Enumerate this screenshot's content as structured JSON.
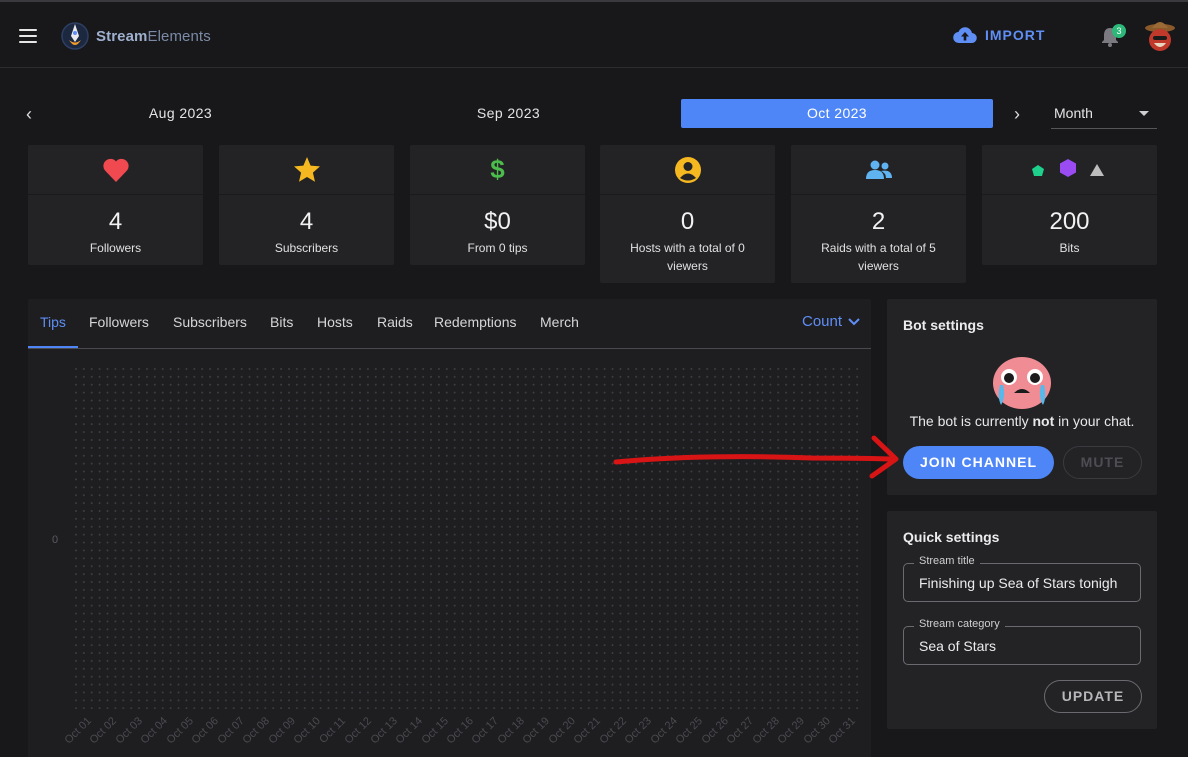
{
  "app": {
    "brand_prefix": "Stream",
    "brand_suffix": "Elements"
  },
  "header": {
    "import_label": "IMPORT",
    "notification_count": "3"
  },
  "date_nav": {
    "months": [
      {
        "label": "Aug 2023",
        "active": false
      },
      {
        "label": "Sep 2023",
        "active": false
      },
      {
        "label": "Oct 2023",
        "active": true
      }
    ],
    "period": "Month"
  },
  "stats": [
    {
      "icon": "heart-icon",
      "value": "4",
      "label": "Followers"
    },
    {
      "icon": "star-icon",
      "value": "4",
      "label": "Subscribers"
    },
    {
      "icon": "dollar-icon",
      "value": "$0",
      "label": "From 0 tips"
    },
    {
      "icon": "user-circle-icon",
      "value": "0",
      "label": "Hosts with a total of 0 viewers"
    },
    {
      "icon": "users-icon",
      "value": "2",
      "label": "Raids with a total of 5 viewers"
    },
    {
      "icon": "gems-icon",
      "value": "200",
      "label": "Bits"
    }
  ],
  "chart_panel": {
    "tabs": [
      "Tips",
      "Followers",
      "Subscribers",
      "Bits",
      "Hosts",
      "Raids",
      "Redemptions",
      "Merch"
    ],
    "active_tab": "Tips",
    "metric_select": "Count"
  },
  "chart_data": {
    "type": "bar",
    "categories": [
      "Oct 01",
      "Oct 02",
      "Oct 03",
      "Oct 04",
      "Oct 05",
      "Oct 06",
      "Oct 07",
      "Oct 08",
      "Oct 09",
      "Oct 10",
      "Oct 11",
      "Oct 12",
      "Oct 13",
      "Oct 14",
      "Oct 15",
      "Oct 16",
      "Oct 17",
      "Oct 18",
      "Oct 19",
      "Oct 20",
      "Oct 21",
      "Oct 22",
      "Oct 23",
      "Oct 24",
      "Oct 25",
      "Oct 26",
      "Oct 27",
      "Oct 28",
      "Oct 29",
      "Oct 30",
      "Oct 31"
    ],
    "values": [
      0,
      0,
      0,
      0,
      0,
      0,
      0,
      0,
      0,
      0,
      0,
      0,
      0,
      0,
      0,
      0,
      0,
      0,
      0,
      0,
      0,
      0,
      0,
      0,
      0,
      0,
      0,
      0,
      0,
      0,
      0
    ],
    "yticks": [
      "0"
    ],
    "grid": true
  },
  "bot_settings": {
    "title": "Bot settings",
    "message_before": "The bot is currently ",
    "message_bold": "not",
    "message_after": " in your chat.",
    "join_label": "JOIN CHANNEL",
    "mute_label": "MUTE"
  },
  "quick_settings": {
    "title": "Quick settings",
    "stream_title_label": "Stream title",
    "stream_title_value": "Finishing up Sea of Stars tonigh",
    "stream_category_label": "Stream category",
    "stream_category_value": "Sea of Stars",
    "update_label": "UPDATE"
  },
  "colors": {
    "accent": "#4f86f7",
    "background": "#18181b",
    "card": "#232326",
    "annotation_arrow": "#d91414"
  }
}
